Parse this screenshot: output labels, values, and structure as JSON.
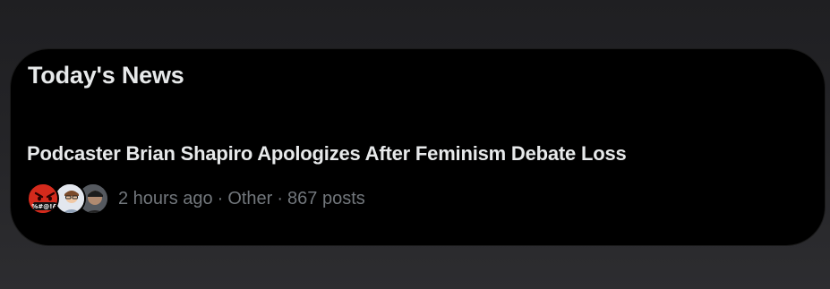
{
  "section": {
    "title": "Today's News"
  },
  "story": {
    "headline": "Podcaster Brian Shapiro Apologizes After Feminism Debate Loss",
    "time": "2 hours ago",
    "category": "Other",
    "posts": "867 posts",
    "separator": "·"
  },
  "avatars": [
    {
      "icon": "angry-face-emoji-icon",
      "text": "%#@!&"
    },
    {
      "icon": "person-avatar-icon"
    },
    {
      "icon": "person-avatar-icon"
    }
  ]
}
